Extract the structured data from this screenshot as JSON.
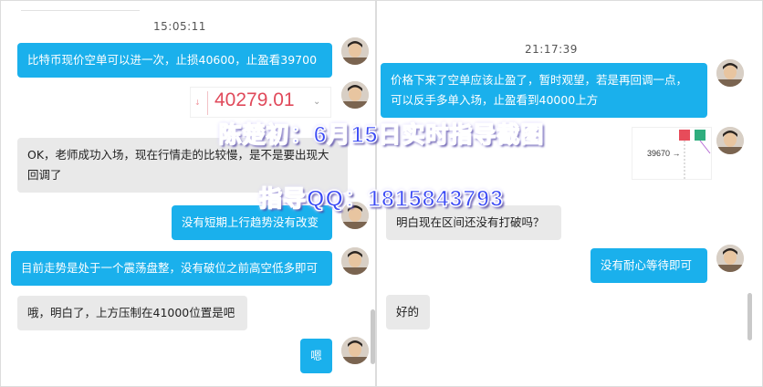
{
  "left_chat": {
    "timestamp": "15:05:11",
    "messages": [
      {
        "text": "比特币现价空单可以进一次，止损40600，止盈看39700"
      },
      {
        "text": "OK，老师成功入场，现在行情走的比较慢，是不是要出现大回调了"
      },
      {
        "text": "没有短期上行趋势没有改变"
      },
      {
        "text": "目前走势是处于一个震荡盘整，没有破位之前高空低多即可"
      },
      {
        "text": "哦，明白了，上方压制在41000位置是吧"
      },
      {
        "text": "嗯"
      }
    ],
    "price_snippet": {
      "value": "40279.01",
      "tick_glyph": "↓",
      "caret": "⌄"
    }
  },
  "right_chat": {
    "timestamp": "21:17:39",
    "messages": [
      {
        "text": "价格下来了空单应该止盈了，暂时观望，若是再回调一点，可以反手多单入场，止盈看到40000上方"
      },
      {
        "text": "明白现在区间还没有打破吗？"
      },
      {
        "text": "没有耐心等待即可"
      },
      {
        "text": "好的"
      }
    ],
    "chart_snippet": {
      "label": "39670 →",
      "up_color": "#2fae7e",
      "down_color": "#e74c5a"
    }
  },
  "watermark": {
    "line1": "陈楚初：6月15日实时指导截图",
    "line2": "指导QQ：1815843793"
  },
  "colors": {
    "accent": "#1ab0ec",
    "bubble_gray": "#e9e9e9",
    "watermark": "#3a49f5"
  }
}
